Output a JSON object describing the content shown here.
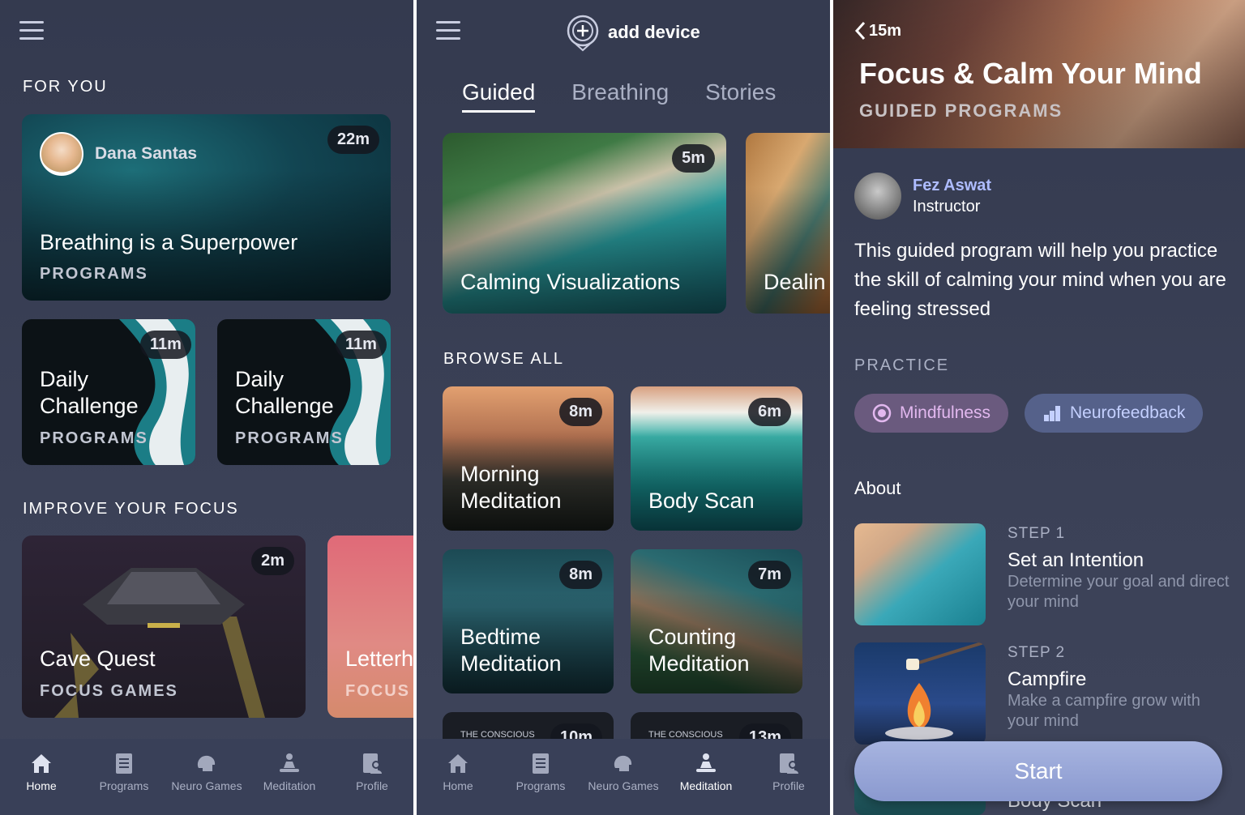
{
  "left": {
    "for_you_title": "FOR YOU",
    "featured": {
      "author": "Dana Santas",
      "duration": "22m",
      "title": "Breathing is a Superpower",
      "category": "PROGRAMS"
    },
    "daily": [
      {
        "title_line1": "Daily",
        "title_line2": "Challenge",
        "category": "PROGRAMS",
        "duration": "11m"
      },
      {
        "title_line1": "Daily",
        "title_line2": "Challenge",
        "category": "PROGRAMS",
        "duration": "11m"
      }
    ],
    "focus_title": "IMPROVE YOUR FOCUS",
    "focus_cards": [
      {
        "title": "Cave Quest",
        "category": "FOCUS GAMES",
        "duration": "2m"
      },
      {
        "title": "Letterh",
        "category": "FOCUS"
      }
    ]
  },
  "middle": {
    "add_device": "add device",
    "tabs": [
      "Guided",
      "Breathing",
      "Stories"
    ],
    "featured": [
      {
        "title": "Calming Visualizations",
        "duration": "5m"
      },
      {
        "title": "Dealin"
      }
    ],
    "browse_title": "BROWSE ALL",
    "grid": [
      {
        "line1": "Morning",
        "line2": "Meditation",
        "duration": "8m"
      },
      {
        "line1": "",
        "line2": "Body Scan",
        "duration": "6m"
      },
      {
        "line1": "Bedtime",
        "line2": "Meditation",
        "duration": "8m"
      },
      {
        "line1": "Counting",
        "line2": "Meditation",
        "duration": "7m"
      },
      {
        "line1": "THE CONSCIOUS",
        "line2": "",
        "duration": "10m"
      },
      {
        "line1": "THE CONSCIOUS",
        "line2": "",
        "duration": "13m"
      }
    ]
  },
  "right": {
    "back": "15m",
    "title": "Focus & Calm Your Mind",
    "category": "GUIDED PROGRAMS",
    "instructor_name": "Fez Aswat",
    "instructor_role": "Instructor",
    "description": "This guided program will help you practice the skill of calming your mind when you are feeling stressed",
    "practice_title": "PRACTICE",
    "chips": [
      "Mindfulness",
      "Neurofeedback"
    ],
    "about_title": "About",
    "steps": [
      {
        "label": "STEP 1",
        "title": "Set an Intention",
        "desc": "Determine your goal and direct your mind"
      },
      {
        "label": "STEP 2",
        "title": "Campfire",
        "desc": "Make a campfire grow with your mind"
      }
    ],
    "peek_text": "Body Scan",
    "start": "Start"
  },
  "nav": {
    "items": [
      "Home",
      "Programs",
      "Neuro Games",
      "Meditation",
      "Profile"
    ]
  },
  "colors": {
    "accent_purple": "#d6a6e8",
    "accent_blue": "#b9c7ff",
    "instructor": "#aebcff"
  }
}
